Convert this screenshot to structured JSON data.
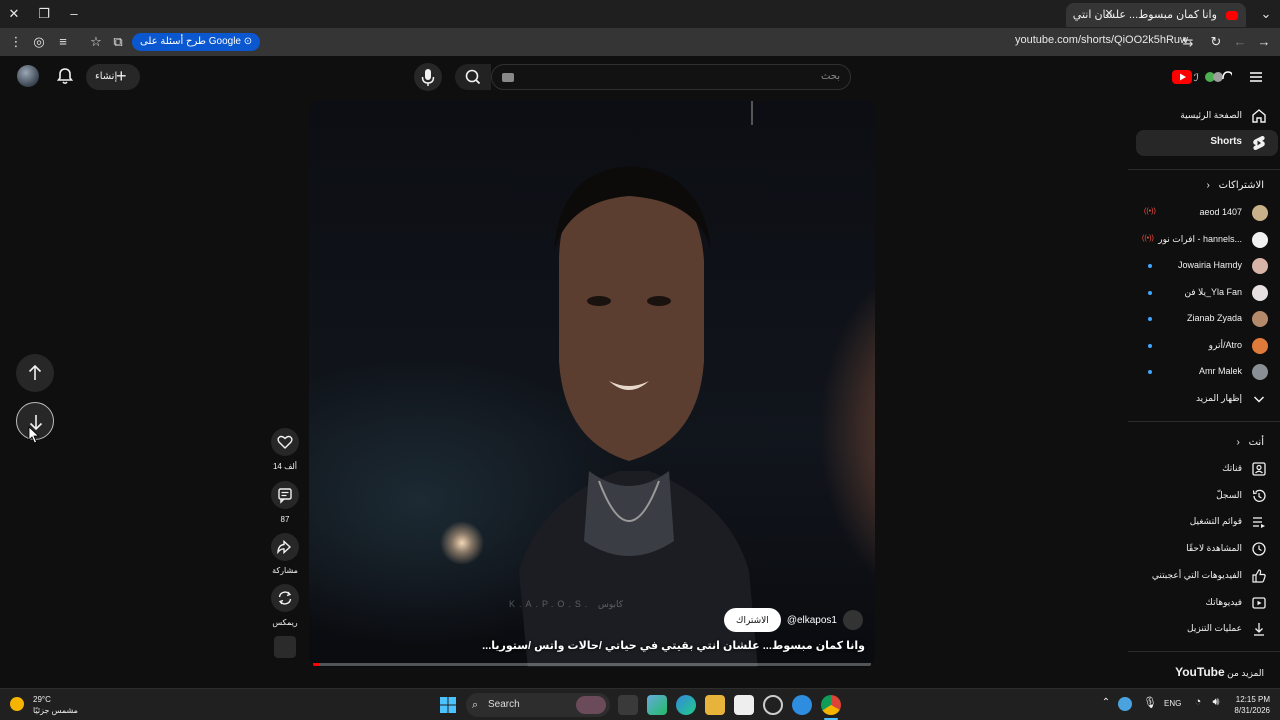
{
  "browser": {
    "tab_title": "وانا كمان مبسوط... علشان انتي",
    "url": "youtube.com/shorts/QiOO2k5hRuw",
    "google_chip": "طرح أسئلة على Google"
  },
  "header": {
    "create_label": "إنشاء",
    "search_placeholder": "بحث"
  },
  "video": {
    "caption": "وانا كمان مبسوط... علشان انتي بقيتي في حياتي /حالات واتس /ستوريا...",
    "channel": "@elkapos1",
    "subscribe_label": "الاشتراك",
    "watermark": "K.A.P.O.S. كابوس",
    "progress": 0.01
  },
  "actions": {
    "likes": "14 ألف",
    "comments": "87",
    "share": "مشاركة",
    "remix": "ريمكس"
  },
  "sidebar": {
    "home": "الصفحة الرئيسية",
    "shorts": "Shorts",
    "subscriptions_head": "الاشتراكات",
    "subscriptions": [
      {
        "name": "aeod 1407",
        "live": true
      },
      {
        "name": "افرات نور - hannels...",
        "live": true
      },
      {
        "name": "Jowairia Hamdy",
        "live": false
      },
      {
        "name": "يلا فن_Yla Fan",
        "live": false
      },
      {
        "name": "Zianab Zyada",
        "live": false
      },
      {
        "name": "أترو/Atro",
        "live": false
      },
      {
        "name": "Amr Malek",
        "live": false
      }
    ],
    "show_more": "إظهار المزيد",
    "you_head": "أنت",
    "you_items": [
      "قناتك",
      "السجلّ",
      "قوائم التشغيل",
      "المشاهدة لاحقًا",
      "الفيديوهات التي أعجبتني",
      "فيديوهاتك",
      "عمليات التنزيل"
    ],
    "more_from_prefix": "المزيد من",
    "more_from_brand": "YouTube"
  },
  "taskbar": {
    "weather_temp": "29°C",
    "weather_desc": "مشمس جزئيًا",
    "search_label": "Search",
    "lang": "ENG",
    "time": "12:15 PM",
    "date": "8/31/2026"
  },
  "colors": {
    "accent": "#ff0000",
    "link_blue": "#3ea6ff",
    "chip_blue": "#0b57d0"
  }
}
